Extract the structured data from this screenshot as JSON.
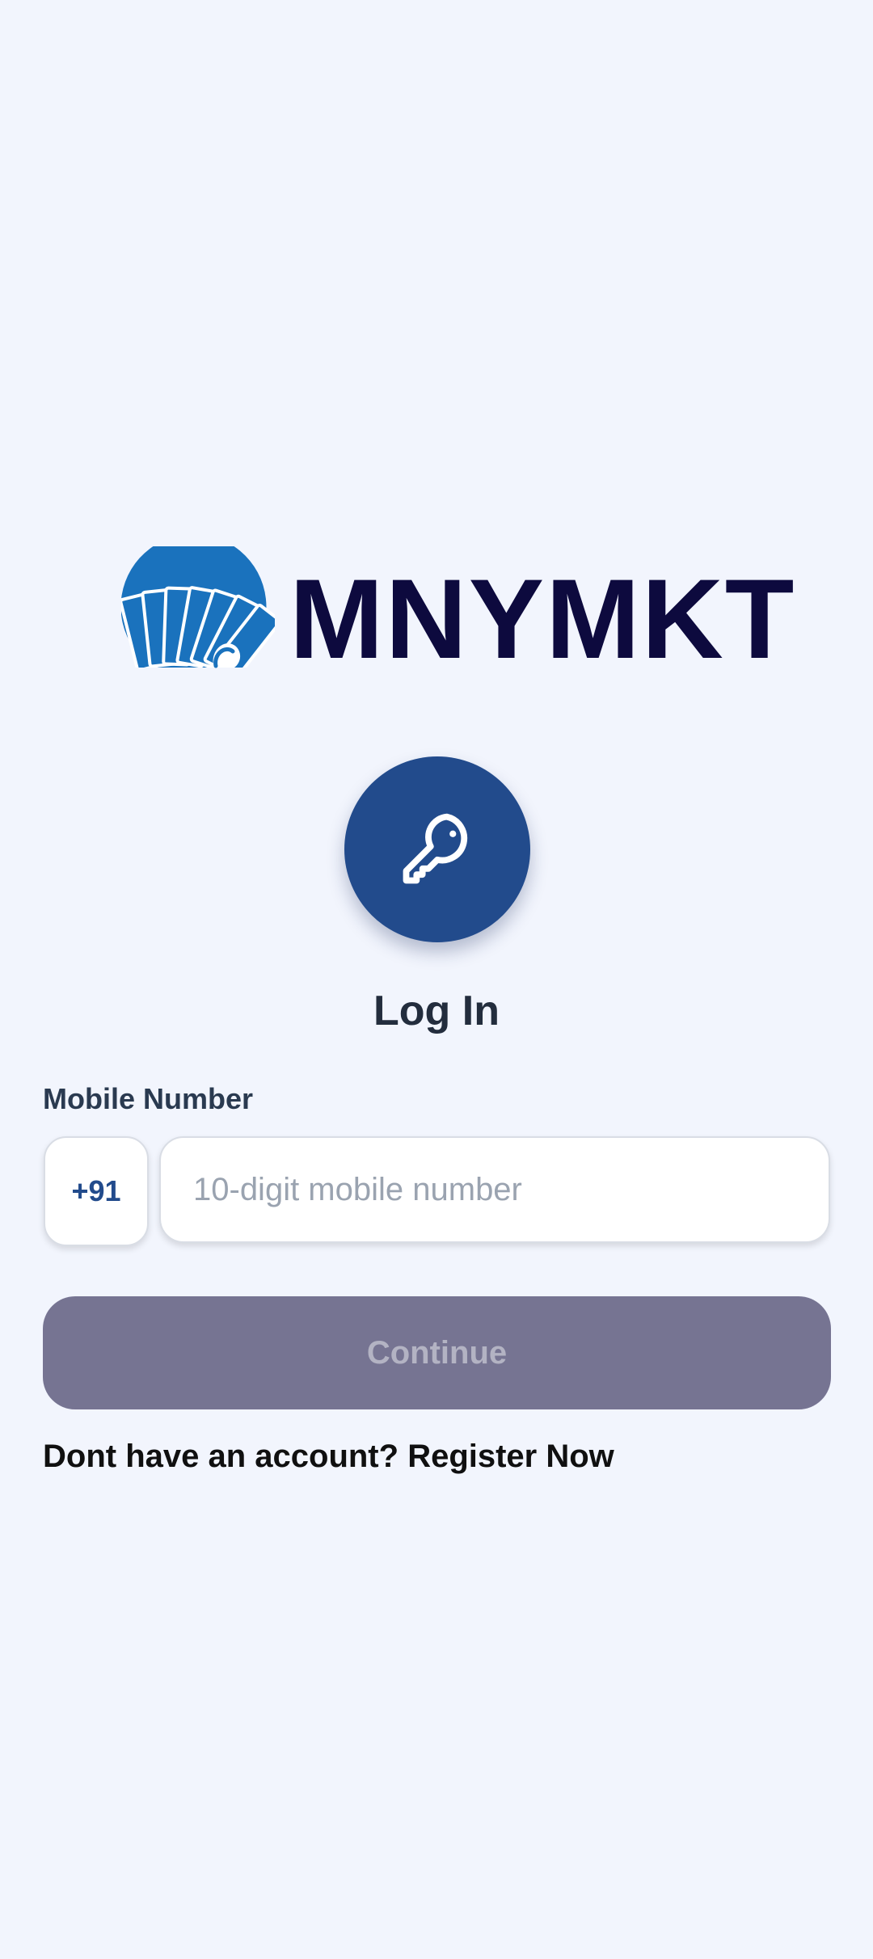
{
  "brand": {
    "name": "MNYMKT",
    "logo_icon": "fanned-cards-logo-icon",
    "primary_color": "#224b8c",
    "logo_blue": "#1a72bd",
    "text_color": "#0d0a3e"
  },
  "login": {
    "icon": "key-icon",
    "title": "Log In",
    "mobile_label": "Mobile Number",
    "country_code": "+91",
    "mobile_placeholder": "10-digit mobile number",
    "mobile_value": "",
    "continue_label": "Continue",
    "continue_disabled": true
  },
  "register": {
    "prompt": "Dont have an account?",
    "link_label": "Register Now"
  }
}
